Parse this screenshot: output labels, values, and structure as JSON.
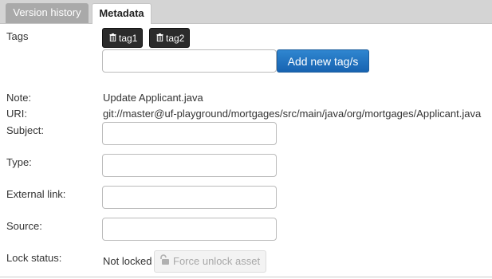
{
  "tabs": [
    {
      "label": "Version history",
      "active": false
    },
    {
      "label": "Metadata",
      "active": true
    }
  ],
  "tags": {
    "label": "Tags",
    "items": [
      {
        "label": "tag1",
        "icon": "trash-icon"
      },
      {
        "label": "tag2",
        "icon": "trash-icon"
      }
    ],
    "new_tag_value": "",
    "add_button_label": "Add new tag/s"
  },
  "note": {
    "label": "Note:",
    "value": "Update Applicant.java"
  },
  "uri": {
    "label": "URI:",
    "value": "git://master@uf-playground/mortgages/src/main/java/org/mortgages/Applicant.java"
  },
  "subject": {
    "label": "Subject:",
    "value": ""
  },
  "type": {
    "label": "Type:",
    "value": ""
  },
  "external_link": {
    "label": "External link:",
    "value": ""
  },
  "source": {
    "label": "Source:",
    "value": ""
  },
  "lock": {
    "label": "Lock status:",
    "value": "Not locked",
    "button_label": "Force unlock asset",
    "button_icon": "unlock-icon"
  },
  "colors": {
    "primary_button": "#1f6fc0",
    "tag_button": "#2b2b2b",
    "tab_bar": "#d4d4d4",
    "inactive_tab": "#a9a9a9"
  }
}
